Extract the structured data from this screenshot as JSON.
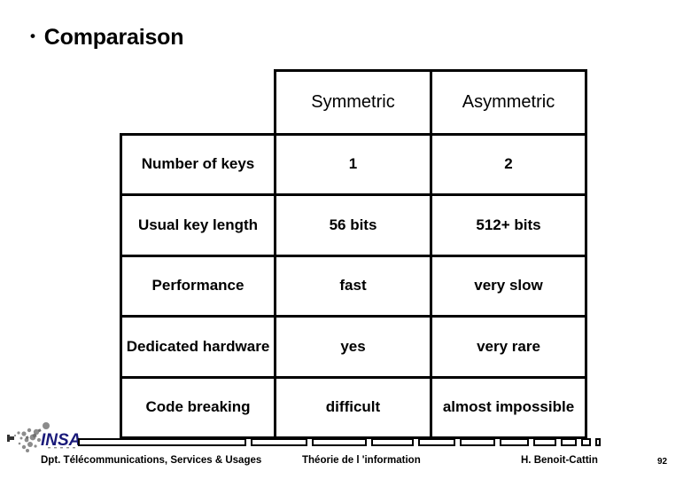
{
  "slide": {
    "bullet": "•",
    "title": "Comparaison",
    "page_number": "92"
  },
  "table": {
    "corner_header": "",
    "columns": [
      "Symmetric",
      "Asymmetric"
    ],
    "rows": [
      {
        "label": "Number of keys",
        "symmetric": "1",
        "asymmetric": "2"
      },
      {
        "label": "Usual key length",
        "symmetric": "56 bits",
        "asymmetric": "512+ bits"
      },
      {
        "label": "Performance",
        "symmetric": "fast",
        "asymmetric": "very slow"
      },
      {
        "label": "Dedicated hardware",
        "symmetric": "yes",
        "asymmetric": "very rare"
      },
      {
        "label": "Code breaking",
        "symmetric": "difficult",
        "asymmetric": "almost impossible"
      }
    ]
  },
  "footer": {
    "logo_text": "INSA",
    "department": "Dpt. Télécommunications, Services & Usages",
    "course": "Théorie de l 'information",
    "author": "H. Benoit-Cattin",
    "page": "92",
    "logo_color": "#1a1a7a",
    "logo_dot_color": "#8c8c8c"
  }
}
